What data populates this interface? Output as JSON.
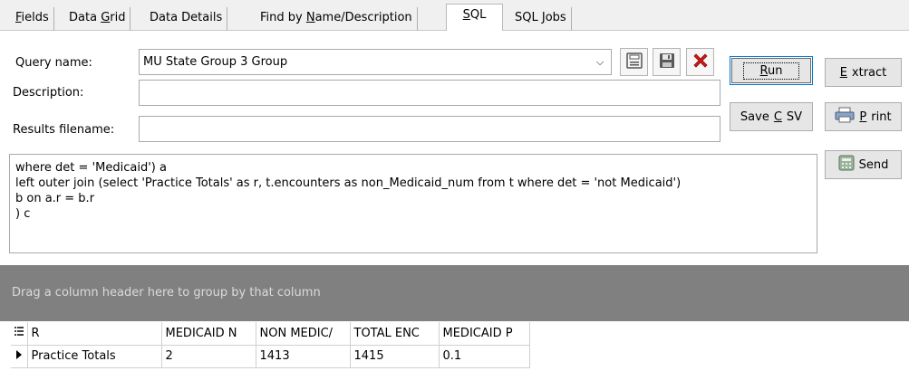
{
  "tabs": [
    {
      "label": "Fields"
    },
    {
      "label": "Data Grid"
    },
    {
      "label": "Data Details"
    },
    {
      "label": "Find by Name/Description"
    },
    {
      "label": "SQL"
    },
    {
      "label": "SQL Jobs"
    }
  ],
  "active_tab": "SQL",
  "form": {
    "query_name_label": "Query name:",
    "query_name_value": "MU State Group 3 Group",
    "description_label": "Description:",
    "description_value": "",
    "results_filename_label": "Results filename:",
    "results_filename_value": ""
  },
  "buttons": {
    "run": "Run",
    "extract": "Extract",
    "save_csv": "Save CSV",
    "print": "Print",
    "send": "Send"
  },
  "sql_text": "where det = 'Medicaid') a\nleft outer join (select 'Practice Totals' as r, t.encounters as non_Medicaid_num from t where det = 'not Medicaid')\nb on a.r = b.r\n) c",
  "grid": {
    "group_hint": "Drag a column header here to group by that column",
    "columns": [
      "R",
      "MEDICAID N",
      "NON MEDIC/",
      "TOTAL ENC",
      "MEDICAID P"
    ],
    "rows": [
      [
        "Practice Totals",
        "2",
        "1413",
        "1415",
        "0.1"
      ]
    ]
  },
  "colors": {
    "group_bar": "#808080",
    "delete_icon": "#d01818",
    "focus_border": "#0078d7"
  }
}
